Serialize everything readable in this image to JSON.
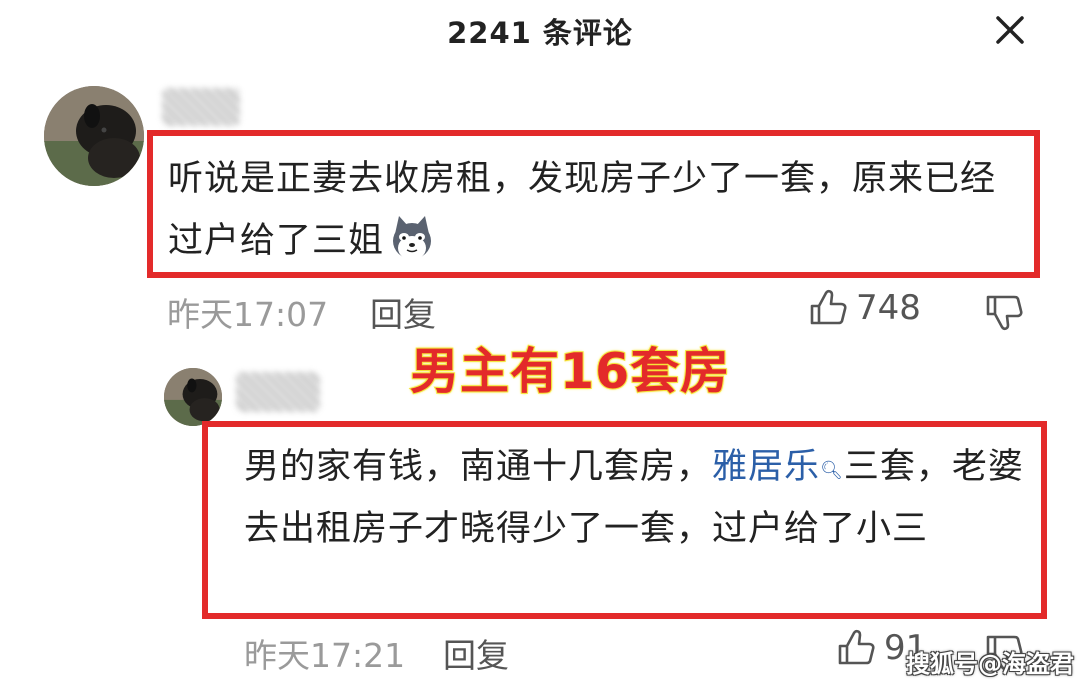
{
  "header": {
    "title": "2241 条评论"
  },
  "comments": [
    {
      "text": "听说是正妻去收房租，发现房子少了一套，原来已经过户给了三姐",
      "time": "昨天17:07",
      "reply_label": "回复",
      "likes": "748",
      "emoji": "dog-emoji"
    },
    {
      "text_before": "男的家有钱，南通十几套房，",
      "link_text": "雅居乐",
      "text_after": "三套，老婆去出租房子才晓得少了一套，过户给了小三",
      "time": "昨天17:21",
      "reply_label": "回复",
      "likes": "91"
    }
  ],
  "overlay_caption": "男主有16套房",
  "watermark": "搜狐号@海盗君",
  "colors": {
    "highlight": "#e32a2a",
    "link": "#2b5fa8",
    "caption_outline": "#f5e43a"
  }
}
